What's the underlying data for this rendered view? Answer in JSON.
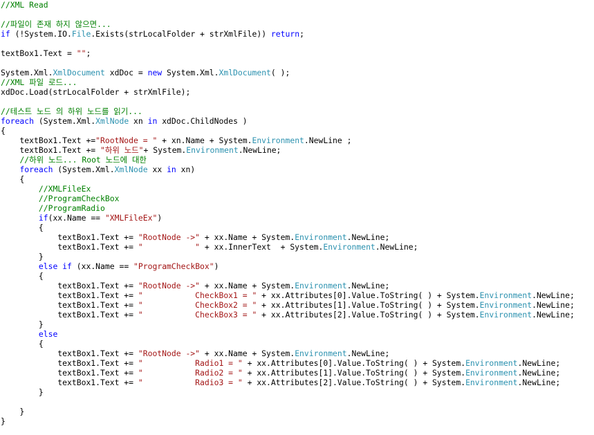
{
  "colors": {
    "background": "#ffffff",
    "plain": "#000000",
    "comment": "#008000",
    "keyword": "#0000ff",
    "type": "#2b91af",
    "string": "#a31515"
  },
  "code_lines": [
    [
      [
        "c",
        "//XML Read"
      ]
    ],
    [],
    [
      [
        "c",
        "//파일이 존재 하지 않으면..."
      ]
    ],
    [
      [
        "k",
        "if"
      ],
      [
        "p",
        " (!System.IO."
      ],
      [
        "t",
        "File"
      ],
      [
        "p",
        ".Exists(strLocalFolder + strXmlFile)) "
      ],
      [
        "k",
        "return"
      ],
      [
        "p",
        ";"
      ]
    ],
    [],
    [
      [
        "p",
        "textBox1.Text = "
      ],
      [
        "s",
        "\"\""
      ],
      [
        "p",
        ";"
      ]
    ],
    [],
    [
      [
        "p",
        "System.Xml."
      ],
      [
        "t",
        "XmlDocument"
      ],
      [
        "p",
        " xdDoc = "
      ],
      [
        "k",
        "new"
      ],
      [
        "p",
        " System.Xml."
      ],
      [
        "t",
        "XmlDocument"
      ],
      [
        "p",
        "( );"
      ]
    ],
    [
      [
        "c",
        "//XML 파일 로드..."
      ]
    ],
    [
      [
        "p",
        "xdDoc.Load(strLocalFolder + strXmlFile);"
      ]
    ],
    [],
    [
      [
        "c",
        "//테스트 노드 의 하위 노드를 읽기..."
      ]
    ],
    [
      [
        "k",
        "foreach"
      ],
      [
        "p",
        " (System.Xml."
      ],
      [
        "t",
        "XmlNode"
      ],
      [
        "p",
        " xn "
      ],
      [
        "k",
        "in"
      ],
      [
        "p",
        " xdDoc.ChildNodes )"
      ]
    ],
    [
      [
        "p",
        "{"
      ]
    ],
    [
      [
        "p",
        "    textBox1.Text +="
      ],
      [
        "s",
        "\"RootNode = \""
      ],
      [
        "p",
        " + xn.Name + System."
      ],
      [
        "t",
        "Environment"
      ],
      [
        "p",
        ".NewLine ;"
      ]
    ],
    [
      [
        "p",
        "    textBox1.Text += "
      ],
      [
        "s",
        "\"하위 노드\""
      ],
      [
        "p",
        "+ System."
      ],
      [
        "t",
        "Environment"
      ],
      [
        "p",
        ".NewLine;"
      ]
    ],
    [
      [
        "p",
        "    "
      ],
      [
        "c",
        "//하위 노드... Root 노드에 대한"
      ]
    ],
    [
      [
        "p",
        "    "
      ],
      [
        "k",
        "foreach"
      ],
      [
        "p",
        " (System.Xml."
      ],
      [
        "t",
        "XmlNode"
      ],
      [
        "p",
        " xx "
      ],
      [
        "k",
        "in"
      ],
      [
        "p",
        " xn)"
      ]
    ],
    [
      [
        "p",
        "    {"
      ]
    ],
    [
      [
        "p",
        "        "
      ],
      [
        "c",
        "//XMLFileEx"
      ]
    ],
    [
      [
        "p",
        "        "
      ],
      [
        "c",
        "//ProgramCheckBox"
      ]
    ],
    [
      [
        "p",
        "        "
      ],
      [
        "c",
        "//ProgramRadio"
      ]
    ],
    [
      [
        "p",
        "        "
      ],
      [
        "k",
        "if"
      ],
      [
        "p",
        "(xx.Name == "
      ],
      [
        "s",
        "\"XMLFileEx\""
      ],
      [
        "p",
        ")"
      ]
    ],
    [
      [
        "p",
        "        {"
      ]
    ],
    [
      [
        "p",
        "            textBox1.Text += "
      ],
      [
        "s",
        "\"RootNode ->\""
      ],
      [
        "p",
        " + xx.Name + System."
      ],
      [
        "t",
        "Environment"
      ],
      [
        "p",
        ".NewLine;"
      ]
    ],
    [
      [
        "p",
        "            textBox1.Text += "
      ],
      [
        "s",
        "\"           \""
      ],
      [
        "p",
        " + xx.InnerText  + System."
      ],
      [
        "t",
        "Environment"
      ],
      [
        "p",
        ".NewLine;"
      ]
    ],
    [
      [
        "p",
        "        }"
      ]
    ],
    [
      [
        "p",
        "        "
      ],
      [
        "k",
        "else if"
      ],
      [
        "p",
        " (xx.Name == "
      ],
      [
        "s",
        "\"ProgramCheckBox\""
      ],
      [
        "p",
        ")"
      ]
    ],
    [
      [
        "p",
        "        {"
      ]
    ],
    [
      [
        "p",
        "            textBox1.Text += "
      ],
      [
        "s",
        "\"RootNode ->\""
      ],
      [
        "p",
        " + xx.Name + System."
      ],
      [
        "t",
        "Environment"
      ],
      [
        "p",
        ".NewLine;"
      ]
    ],
    [
      [
        "p",
        "            textBox1.Text += "
      ],
      [
        "s",
        "\"           CheckBox1 = \""
      ],
      [
        "p",
        " + xx.Attributes[0].Value.ToString( ) + System."
      ],
      [
        "t",
        "Environment"
      ],
      [
        "p",
        ".NewLine;"
      ]
    ],
    [
      [
        "p",
        "            textBox1.Text += "
      ],
      [
        "s",
        "\"           CheckBox2 = \""
      ],
      [
        "p",
        " + xx.Attributes[1].Value.ToString( ) + System."
      ],
      [
        "t",
        "Environment"
      ],
      [
        "p",
        ".NewLine;"
      ]
    ],
    [
      [
        "p",
        "            textBox1.Text += "
      ],
      [
        "s",
        "\"           CheckBox3 = \""
      ],
      [
        "p",
        " + xx.Attributes[2].Value.ToString( ) + System."
      ],
      [
        "t",
        "Environment"
      ],
      [
        "p",
        ".NewLine;"
      ]
    ],
    [
      [
        "p",
        "        }"
      ]
    ],
    [
      [
        "p",
        "        "
      ],
      [
        "k",
        "else"
      ]
    ],
    [
      [
        "p",
        "        {"
      ]
    ],
    [
      [
        "p",
        "            textBox1.Text += "
      ],
      [
        "s",
        "\"RootNode ->\""
      ],
      [
        "p",
        " + xx.Name + System."
      ],
      [
        "t",
        "Environment"
      ],
      [
        "p",
        ".NewLine;"
      ]
    ],
    [
      [
        "p",
        "            textBox1.Text += "
      ],
      [
        "s",
        "\"           Radio1 = \""
      ],
      [
        "p",
        " + xx.Attributes[0].Value.ToString( ) + System."
      ],
      [
        "t",
        "Environment"
      ],
      [
        "p",
        ".NewLine;"
      ]
    ],
    [
      [
        "p",
        "            textBox1.Text += "
      ],
      [
        "s",
        "\"           Radio2 = \""
      ],
      [
        "p",
        " + xx.Attributes[1].Value.ToString( ) + System."
      ],
      [
        "t",
        "Environment"
      ],
      [
        "p",
        ".NewLine;"
      ]
    ],
    [
      [
        "p",
        "            textBox1.Text += "
      ],
      [
        "s",
        "\"           Radio3 = \""
      ],
      [
        "p",
        " + xx.Attributes[2].Value.ToString( ) + System."
      ],
      [
        "t",
        "Environment"
      ],
      [
        "p",
        ".NewLine;"
      ]
    ],
    [
      [
        "p",
        "        }"
      ]
    ],
    [],
    [
      [
        "p",
        "    }"
      ]
    ],
    [
      [
        "p",
        "}"
      ]
    ]
  ]
}
